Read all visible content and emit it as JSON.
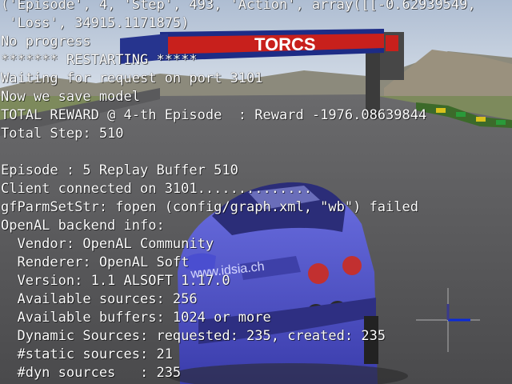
{
  "scene": {
    "banner_text": "TORCS",
    "car_plate_text": "www.idsia.ch",
    "colors": {
      "sky_top": "#b8c6d8",
      "sky_bottom": "#dfe6ee",
      "track": "#5e5e60",
      "grass": "#6b8a3c",
      "car_body": "#4c4fc8",
      "banner_red": "#c8201c",
      "banner_blue": "#1c2a8c",
      "hud_axis": "#0a2ad8",
      "hud_axis_y": "#3a3a8c"
    }
  },
  "terminal": {
    "text_color": "#ffffff",
    "lines": [
      "('Episode', 4, 'Step', 493, 'Action', array([[-0.62939549,",
      " 'Loss', 34915.1171875)",
      "No progress",
      "******* RESTARTING *****",
      "Waiting for request on port 3101",
      "Now we save model",
      "TOTAL REWARD @ 4-th Episode  : Reward -1976.08639844",
      "Total Step: 510",
      "",
      "Episode : 5 Replay Buffer 510",
      "Client connected on 3101..............",
      "gfParmSetStr: fopen (config/graph.xml, \"wb\") failed",
      "OpenAL backend info:",
      "  Vendor: OpenAL Community",
      "  Renderer: OpenAL Soft",
      "  Version: 1.1 ALSOFT 1.17.0",
      "  Available sources: 256",
      "  Available buffers: 1024 or more",
      "  Dynamic Sources: requested: 235, created: 235",
      "  #static sources: 21",
      "  #dyn sources   : 235"
    ]
  }
}
